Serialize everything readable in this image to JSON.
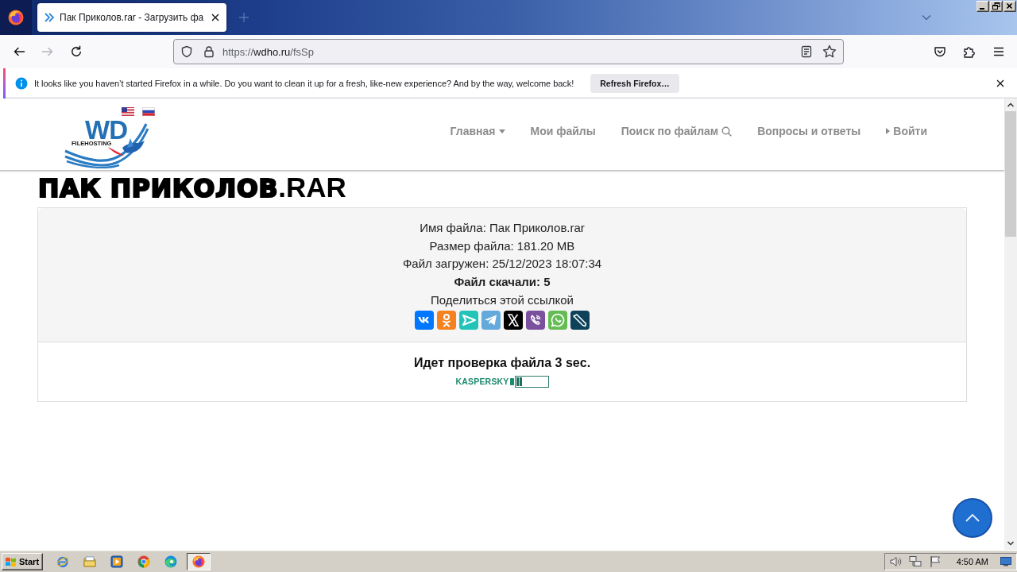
{
  "browser": {
    "tabs": [
      {
        "title": "Пак Приколов.rar - Загрузить фа",
        "selected": true
      }
    ],
    "nav_buttons": [
      {
        "kind": "back",
        "disabled": false
      },
      {
        "kind": "forward",
        "disabled": true
      },
      {
        "kind": "reload",
        "disabled": false
      }
    ],
    "address_bar": {
      "scheme": "https://",
      "host": "wdho.ru",
      "path": "/fsSp"
    },
    "notification": {
      "message": "It looks like you haven’t started Firefox in a while. Do you want to clean it up for a fresh, like-new experience? And by the way, welcome back!",
      "button": "Refresh Firefox…"
    }
  },
  "site": {
    "logo": {
      "title": "WD",
      "subtitle": "FILEHOSTING"
    },
    "nav": [
      {
        "label": "Главная",
        "kind": "dropdown"
      },
      {
        "label": "Мои файлы",
        "kind": "link"
      },
      {
        "label": "Поиск по файлам",
        "kind": "search"
      },
      {
        "label": "Вопросы и ответы",
        "kind": "link"
      },
      {
        "label": "Войти",
        "kind": "login"
      }
    ],
    "page_title": "**ПАК ПРИКОЛОВ**.RAR",
    "file_info": [
      {
        "text": "Имя файла: Пак Приколов.rar",
        "kind": "plain"
      },
      {
        "text": "Размер файла: 181.20 MB",
        "kind": "plain"
      },
      {
        "text": "Файл загружен: 25/12/2023 18:07:34",
        "kind": "plain"
      },
      {
        "text": "Файл скачали: 5",
        "kind": "bold"
      },
      {
        "text": "Поделиться этой ссылкой",
        "kind": "plain"
      }
    ],
    "share_buttons": [
      {
        "kind": "vk",
        "color": "#0077ff"
      },
      {
        "kind": "ok",
        "color": "#f58220"
      },
      {
        "kind": "messenger",
        "color": "#22c4b8"
      },
      {
        "kind": "telegram",
        "color": "#64a9dc"
      },
      {
        "kind": "x",
        "color": "#000000"
      },
      {
        "kind": "viber",
        "color": "#7b519d"
      },
      {
        "kind": "whatsapp",
        "color": "#65bc54"
      },
      {
        "kind": "livejournal",
        "color": "#0d425a"
      }
    ],
    "scan": {
      "message": "Идет проверка файла 3 sec.",
      "vendor": "KASPERSKY",
      "level": 0.2
    }
  },
  "taskbar": {
    "start": "Start",
    "quick_launch": [
      {
        "kind": "ie"
      },
      {
        "kind": "folder"
      },
      {
        "kind": "media"
      },
      {
        "kind": "chrome"
      },
      {
        "kind": "edge"
      }
    ],
    "tasks": [
      {
        "kind": "firefox",
        "selected": true
      }
    ],
    "clock": "4:50 AM"
  }
}
